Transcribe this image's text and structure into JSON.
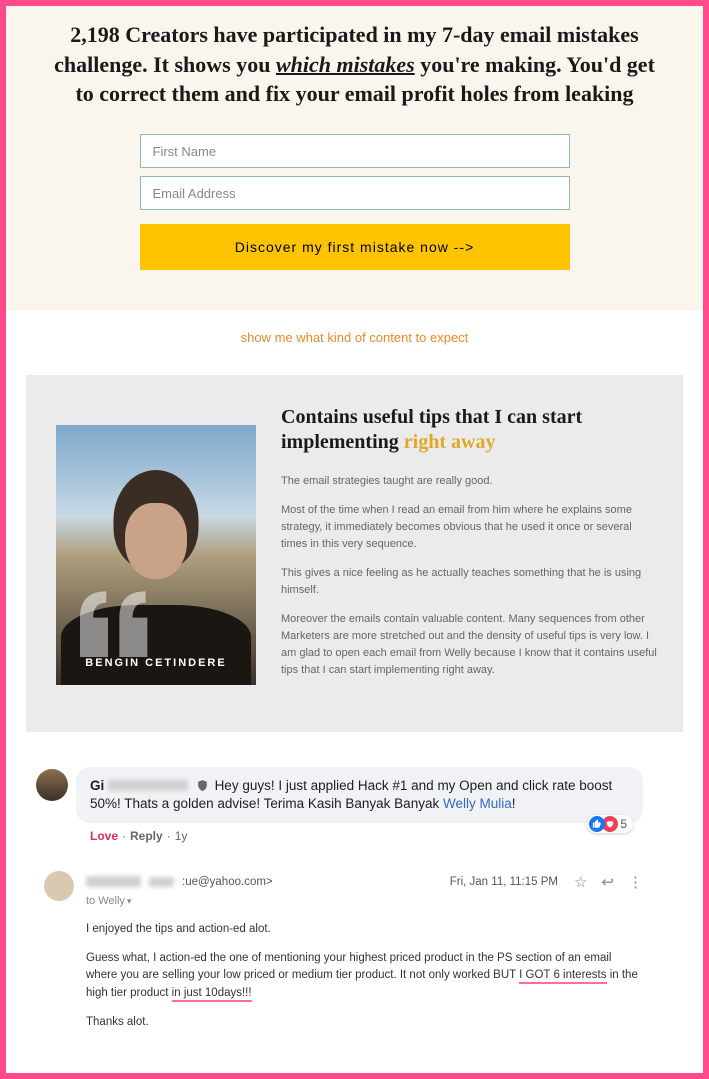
{
  "hero": {
    "headline_pre": "2,198 Creators have participated in my 7-day email mistakes challenge. It shows you ",
    "headline_underline": "which mistakes",
    "headline_post": " you're making. You'd get to correct them and fix your email profit holes from leaking",
    "first_name_placeholder": "First Name",
    "email_placeholder": "Email Address",
    "cta_label": "Discover my first mistake now -->",
    "expect_link": "show me what kind of content to expect"
  },
  "testimonial": {
    "name": "BENGIN CETINDERE",
    "heading_pre": "Contains useful tips that I can start implementing ",
    "heading_gold": "right away",
    "p1": "The email strategies taught are really good.",
    "p2": "Most of the time when I read an email from him where he explains some strategy, it immediately becomes obvious that he used it once or several times in this very sequence.",
    "p3": "This gives a nice feeling as he actually teaches something that he is using himself.",
    "p4": "Moreover the emails contain valuable content. Many sequences from other Marketers are more stretched out and the density of useful tips is very low. I am glad to open each email from Welly because I know that it contains useful tips that I can start implementing right away."
  },
  "fb": {
    "name": "Gi",
    "text1": "Hey guys! I just applied Hack #1 and my Open and click rate boost 50%! Thats a golden advise! Terima Kasih Banyak Banyak ",
    "link_name": "Welly Mulia",
    "text2": "!",
    "love": "Love",
    "reply": "Reply",
    "age": "1y",
    "reaction_count": "5"
  },
  "email": {
    "addr_suffix": ":ue@yahoo.com>",
    "date": "Fri, Jan 11, 11:15 PM",
    "to_line": "to Welly",
    "p1": "I enjoyed the tips and action-ed alot.",
    "p2_pre": "Guess what, I action-ed the one of mentioning your highest priced product in the PS section of an email where you are selling your low priced or medium tier product. It not only worked BUT ",
    "p2_u1": "I GOT 6 interests",
    "p2_mid": " in the high tier product ",
    "p2_u2": "in just 10days!!!",
    "p3": "Thanks alot."
  }
}
